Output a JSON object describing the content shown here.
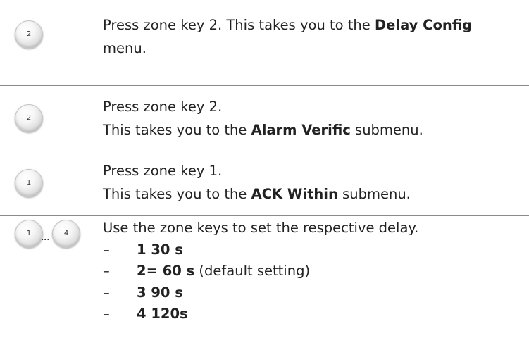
{
  "steps": [
    {
      "keys": [
        "2"
      ],
      "line1_pre": "Press zone key 2. This takes you to the ",
      "line1_bold": "Delay Config",
      "line2": "menu."
    },
    {
      "keys": [
        "2"
      ],
      "line1": "Press zone key 2.",
      "line2_pre": "This takes you to the ",
      "line2_bold": "Alarm Verific",
      "line2_post": " submenu."
    },
    {
      "keys": [
        "1"
      ],
      "line1": "Press zone key 1.",
      "line2_pre": "This takes you to the ",
      "line2_bold": "ACK Within",
      "line2_post": " submenu."
    },
    {
      "keys": [
        "1",
        "4"
      ],
      "key_separator": "...",
      "line1": "Use the zone keys to set the respective delay.",
      "options": [
        {
          "dash": "–",
          "bold": "1 30 s",
          "note": ""
        },
        {
          "dash": "–",
          "bold": "2= 60 s",
          "note": " (default setting)"
        },
        {
          "dash": "–",
          "bold": "3 90 s",
          "note": ""
        },
        {
          "dash": "–",
          "bold": "4 120s",
          "note": ""
        }
      ]
    }
  ]
}
